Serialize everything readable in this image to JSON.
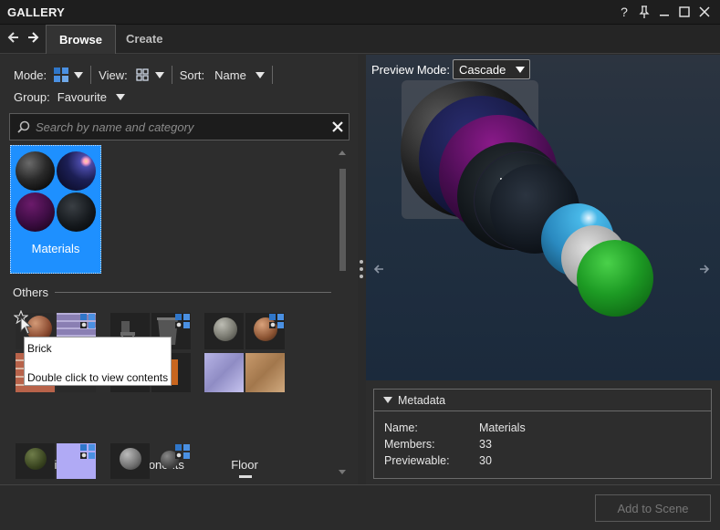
{
  "window": {
    "title": "GALLERY",
    "controls": [
      "?",
      "pin",
      "minimize",
      "maximize",
      "close"
    ]
  },
  "tabs": [
    {
      "label": "Browse",
      "active": true
    },
    {
      "label": "Create",
      "active": false
    }
  ],
  "toolbar": {
    "mode_label": "Mode:",
    "view_label": "View:",
    "sort_label": "Sort:",
    "sort_value": "Name",
    "group_label": "Group:",
    "group_value": "Favourite"
  },
  "search": {
    "placeholder": "Search by name and category"
  },
  "favourites": [
    {
      "label": "Materials",
      "selected": true
    }
  ],
  "others_section": {
    "title": "Others",
    "items": [
      {
        "label": "Brick"
      },
      {
        "label": "Components"
      },
      {
        "label": "Floor"
      }
    ]
  },
  "tooltip": {
    "title": "Brick",
    "text": "Double click to view contents"
  },
  "preview": {
    "mode_label": "Preview Mode:",
    "mode_value": "Cascade"
  },
  "metadata": {
    "title": "Metadata",
    "rows": [
      {
        "key": "Name:",
        "value": "Materials"
      },
      {
        "key": "Members:",
        "value": "33"
      },
      {
        "key": "Previewable:",
        "value": "30"
      }
    ]
  },
  "footer": {
    "add_button": "Add to Scene"
  },
  "colors": {
    "accent": "#1e90ff",
    "background": "#2d2d2d"
  }
}
